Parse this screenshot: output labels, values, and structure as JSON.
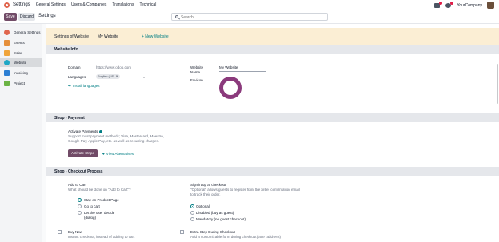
{
  "topnav": {
    "app_name": "Settings",
    "menu": [
      "General Settings",
      "Users & Companies",
      "Translations",
      "Technical"
    ],
    "company": "YourCompany"
  },
  "controlbar": {
    "save_label": "Save",
    "discard_label": "Discard",
    "breadcrumb": "Settings",
    "search_placeholder": "Search..."
  },
  "sidebar": {
    "items": [
      {
        "label": "General Settings",
        "color": "#e0664e"
      },
      {
        "label": "Events",
        "color": "#e58f3b"
      },
      {
        "label": "Sales",
        "color": "#f0a43a"
      },
      {
        "label": "Website",
        "color": "#1ea7c5"
      },
      {
        "label": "Invoicing",
        "color": "#2b7ed3"
      },
      {
        "label": "Project",
        "color": "#6bb344"
      }
    ],
    "active_index": 3
  },
  "banner": {
    "label": "Settings of Website",
    "value": "My Website",
    "link": "+ New Website"
  },
  "website_info": {
    "title": "Website Info",
    "domain_label": "Domain",
    "domain_placeholder": "https://www.odoo.com",
    "languages_label": "Languages",
    "language_tag": "English (US)",
    "install_link": "Install languages",
    "website_name_label": "Website Name",
    "website_name_value": "My Website",
    "favicon_label": "Favicon"
  },
  "shop_payment": {
    "title": "Shop - Payment",
    "activate_label": "Activate Payments",
    "activate_desc": "Support most payment methods; Visa, Mastercard, Maestro, Google Pay, Apple Pay, etc. as well as recurring charges.",
    "activate_button": "Activate Stripe",
    "alternatives_link": "View Alternatives"
  },
  "checkout": {
    "title": "Shop - Checkout Process",
    "add_to_cart_label": "Add to Cart",
    "add_to_cart_desc": "What should be done on \"Add to Cart\"?",
    "add_to_cart_options": [
      "Stay on Product Page",
      "Go to cart",
      "Let the user decide",
      "(dialog)"
    ],
    "add_to_cart_selected": 0,
    "sign_label": "Sign in/up at checkout",
    "sign_desc": "\"Optional\" allows guests to register from the order confirmation email to track their order.",
    "sign_options": [
      "Optional",
      "Disabled (buy as guest)",
      "Mandatory (no guest checkout)"
    ],
    "sign_selected": 0,
    "buy_now_label": "Buy Now",
    "buy_now_desc": "Instant checkout, instead of adding to cart",
    "extra_step_label": "Extra Step During Checkout",
    "extra_step_desc": "Add a customizable form during checkout (after address)"
  }
}
